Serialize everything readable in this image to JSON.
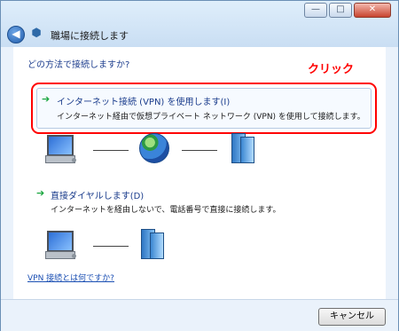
{
  "window": {
    "title": "職場に接続します",
    "controls": {
      "minimize": "—",
      "maximize": "□",
      "close": "✕"
    }
  },
  "content": {
    "question": "どの方法で接続しますか?",
    "annotation": "クリック",
    "options": [
      {
        "arrow": "➔",
        "title": "インターネット接続 (VPN) を使用します(I)",
        "description": "インターネット経由で仮想プライベート ネットワーク (VPN) を使用して接続します。"
      },
      {
        "arrow": "➔",
        "title": "直接ダイヤルします(D)",
        "description": "インターネットを経由しないで、電話番号で直接に接続します。"
      }
    ],
    "link": "VPN 接続とは何ですか?"
  },
  "footer": {
    "cancel": "キャンセル"
  },
  "icons": {
    "back": "back-arrow-icon",
    "network": "network-icon",
    "computer": "computer-icon",
    "globe": "globe-icon",
    "server": "server-icon"
  }
}
